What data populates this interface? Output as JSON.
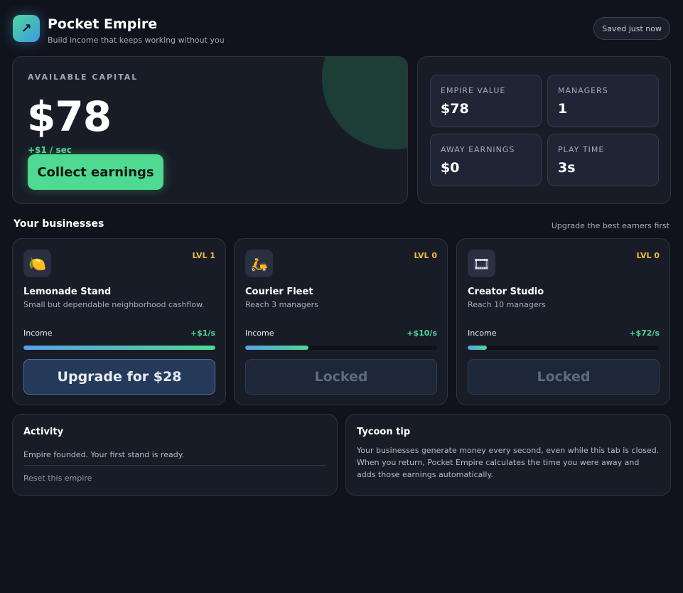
{
  "header": {
    "title": "Pocket Empire",
    "subtitle": "Build income that keeps working without you",
    "logo_icon": "arrow-up-right-icon",
    "saved_status": "Saved just now"
  },
  "capital": {
    "label": "AVAILABLE CAPITAL",
    "value": "$78",
    "rate": "+$1 / sec",
    "collect_label": "Collect earnings"
  },
  "stats": [
    {
      "label": "EMPIRE VALUE",
      "value": "$78"
    },
    {
      "label": "MANAGERS",
      "value": "1"
    },
    {
      "label": "AWAY EARNINGS",
      "value": "$0"
    },
    {
      "label": "PLAY TIME",
      "value": "3s"
    }
  ],
  "businesses_section": {
    "title": "Your businesses",
    "hint": "Upgrade the best earners first"
  },
  "businesses": [
    {
      "icon": "lemon-icon",
      "glyph": "🍋",
      "level": "LVL 1",
      "name": "Lemonade Stand",
      "description": "Small but dependable neighborhood cashflow.",
      "income_label": "Income",
      "income": "+$1/s",
      "progress": 1.0,
      "button_label": "Upgrade for $28",
      "locked": false
    },
    {
      "icon": "scooter-icon",
      "glyph": "🛵",
      "level": "LVL 0",
      "name": "Courier Fleet",
      "description": "Reach 3 managers",
      "income_label": "Income",
      "income": "+$10/s",
      "progress": 0.33,
      "button_label": "Locked",
      "locked": true
    },
    {
      "icon": "film-frames-icon",
      "glyph": "🎞",
      "level": "LVL 0",
      "name": "Creator Studio",
      "description": "Reach 10 managers",
      "income_label": "Income",
      "income": "+$72/s",
      "progress": 0.1,
      "button_label": "Locked",
      "locked": true
    }
  ],
  "activity": {
    "title": "Activity",
    "entries": [
      "Empire founded. Your first stand is ready."
    ],
    "reset_label": "Reset this empire"
  },
  "tip": {
    "title": "Tycoon tip",
    "text": "Your businesses generate money every second, even while this tab is closed. When you return, Pocket Empire calculates the time you were away and adds those earnings automatically."
  },
  "colors": {
    "accent_green": "#4fd991",
    "level_gold": "#f5b942",
    "background": "#10131b"
  }
}
